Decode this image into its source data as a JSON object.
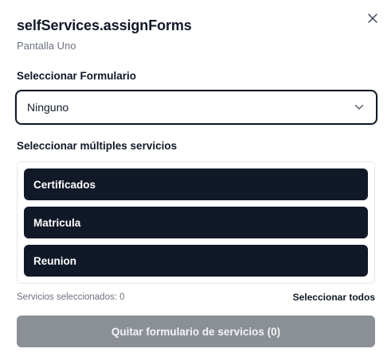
{
  "dialog": {
    "title": "selfServices.assignForms",
    "subtitle": "Pantalla Uno",
    "close_icon": "close-icon"
  },
  "form_select": {
    "label": "Seleccionar Formulario",
    "value": "Ninguno",
    "icon": "chevron-down-icon"
  },
  "services": {
    "label": "Seleccionar múltiples servicios",
    "items": [
      {
        "label": "Certificados"
      },
      {
        "label": "Matricula"
      },
      {
        "label": "Reunion"
      }
    ],
    "selected_count_text": "Servicios seleccionados: 0",
    "select_all_label": "Seleccionar todos"
  },
  "actions": {
    "remove_label": "Quitar formulario de servicios (0)"
  },
  "colors": {
    "item_bg": "#111827",
    "disabled_button": "#8b8f96"
  }
}
